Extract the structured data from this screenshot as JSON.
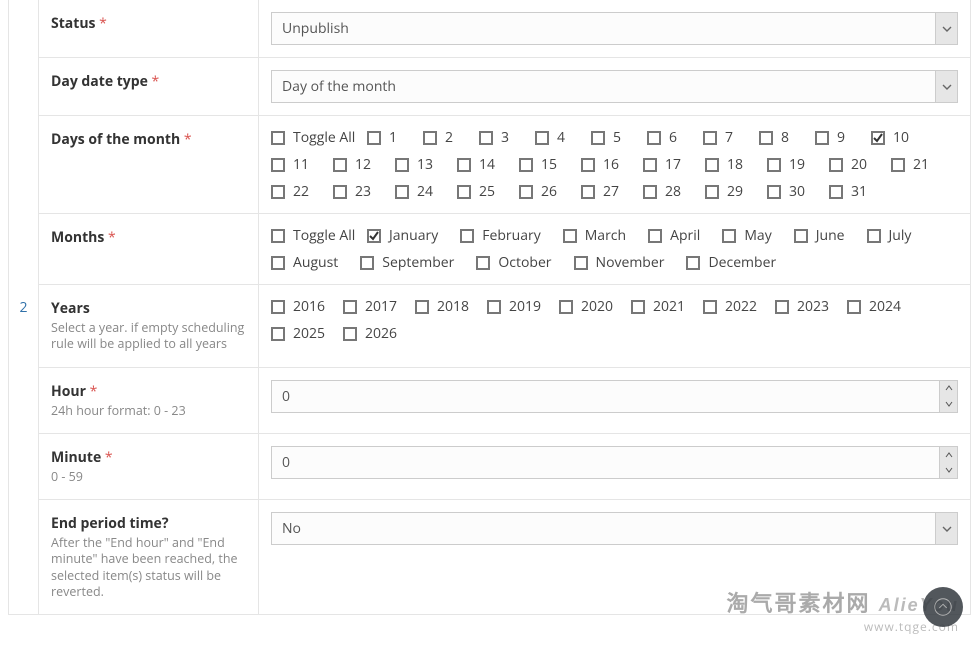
{
  "rowIndex": "2",
  "status": {
    "label": "Status",
    "value": "Unpublish"
  },
  "dayDateType": {
    "label": "Day date type",
    "value": "Day of the month"
  },
  "daysOfMonth": {
    "label": "Days of the month",
    "toggleLabel": "Toggle All",
    "items": [
      {
        "label": "1",
        "checked": false
      },
      {
        "label": "2",
        "checked": false
      },
      {
        "label": "3",
        "checked": false
      },
      {
        "label": "4",
        "checked": false
      },
      {
        "label": "5",
        "checked": false
      },
      {
        "label": "6",
        "checked": false
      },
      {
        "label": "7",
        "checked": false
      },
      {
        "label": "8",
        "checked": false
      },
      {
        "label": "9",
        "checked": false
      },
      {
        "label": "10",
        "checked": true
      },
      {
        "label": "11",
        "checked": false
      },
      {
        "label": "12",
        "checked": false
      },
      {
        "label": "13",
        "checked": false
      },
      {
        "label": "14",
        "checked": false
      },
      {
        "label": "15",
        "checked": false
      },
      {
        "label": "16",
        "checked": false
      },
      {
        "label": "17",
        "checked": false
      },
      {
        "label": "18",
        "checked": false
      },
      {
        "label": "19",
        "checked": false
      },
      {
        "label": "20",
        "checked": false
      },
      {
        "label": "21",
        "checked": false
      },
      {
        "label": "22",
        "checked": false
      },
      {
        "label": "23",
        "checked": false
      },
      {
        "label": "24",
        "checked": false
      },
      {
        "label": "25",
        "checked": false
      },
      {
        "label": "26",
        "checked": false
      },
      {
        "label": "27",
        "checked": false
      },
      {
        "label": "28",
        "checked": false
      },
      {
        "label": "29",
        "checked": false
      },
      {
        "label": "30",
        "checked": false
      },
      {
        "label": "31",
        "checked": false
      }
    ]
  },
  "months": {
    "label": "Months",
    "toggleLabel": "Toggle All",
    "items": [
      {
        "label": "January",
        "checked": true
      },
      {
        "label": "February",
        "checked": false
      },
      {
        "label": "March",
        "checked": false
      },
      {
        "label": "April",
        "checked": false
      },
      {
        "label": "May",
        "checked": false
      },
      {
        "label": "June",
        "checked": false
      },
      {
        "label": "July",
        "checked": false
      },
      {
        "label": "August",
        "checked": false
      },
      {
        "label": "September",
        "checked": false
      },
      {
        "label": "October",
        "checked": false
      },
      {
        "label": "November",
        "checked": false
      },
      {
        "label": "December",
        "checked": false
      }
    ]
  },
  "years": {
    "label": "Years",
    "help": "Select a year. if empty scheduling rule will be applied to all years",
    "items": [
      {
        "label": "2016",
        "checked": false
      },
      {
        "label": "2017",
        "checked": false
      },
      {
        "label": "2018",
        "checked": false
      },
      {
        "label": "2019",
        "checked": false
      },
      {
        "label": "2020",
        "checked": false
      },
      {
        "label": "2021",
        "checked": false
      },
      {
        "label": "2022",
        "checked": false
      },
      {
        "label": "2023",
        "checked": false
      },
      {
        "label": "2024",
        "checked": false
      },
      {
        "label": "2025",
        "checked": false
      },
      {
        "label": "2026",
        "checked": false
      }
    ]
  },
  "hour": {
    "label": "Hour",
    "help": "24h hour format: 0 - 23",
    "value": "0"
  },
  "minute": {
    "label": "Minute",
    "help": "0 - 59",
    "value": "0"
  },
  "endPeriod": {
    "label": "End period time?",
    "help": "After the \"End hour\" and \"End minute\" have been reached, the selected item(s) status will be reverted.",
    "value": "No"
  },
  "watermark": {
    "line1": "淘气哥素材网",
    "line2": "www.tqge.com",
    "brand": "AlieYou"
  }
}
